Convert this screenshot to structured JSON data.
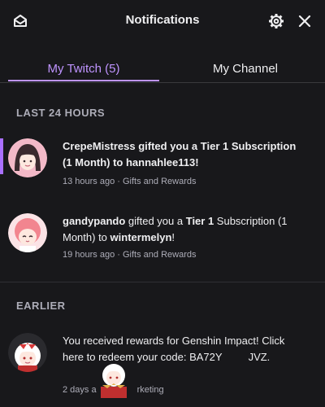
{
  "header": {
    "title": "Notifications",
    "icons": {
      "mail": "mail-open-icon",
      "settings": "gear-icon",
      "close": "close-icon"
    }
  },
  "tabs": [
    {
      "label": "My Twitch (5)",
      "active": true
    },
    {
      "label": "My Channel",
      "active": false
    }
  ],
  "sections": {
    "recent_label": "LAST 24 HOURS",
    "earlier_label": "EARLIER"
  },
  "notifications": [
    {
      "unread": true,
      "parts": [
        "CrepeMistress gifted you a Tier 1 Subscription (1 Month) to hannahlee113!"
      ],
      "meta": "13 hours ago · Gifts and Rewards"
    },
    {
      "unread": false,
      "parts": [
        "gandypando",
        " gifted you a ",
        "Tier 1",
        " Subscription (1 Month) to ",
        "wintermelyn",
        "!"
      ],
      "meta": "19 hours ago · Gifts and Rewards"
    },
    {
      "unread": false,
      "parts": [
        "You received rewards for Genshin Impact! Click here to redeem your code: BA72Y",
        "JVZ."
      ],
      "meta_left": "2 days a",
      "meta_right": "rketing"
    }
  ],
  "colors": {
    "background": "#18181b",
    "accent": "#bf94ff",
    "unread_bar": "#a970ff",
    "text": "#efeff1",
    "muted": "#adadb8"
  }
}
